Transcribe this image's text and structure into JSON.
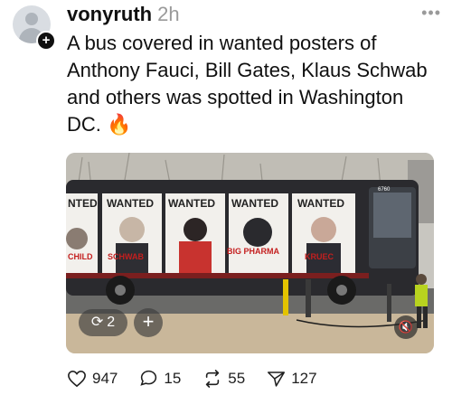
{
  "post": {
    "username": "vonyruth",
    "time": "2h",
    "caption": "A bus covered in wanted posters of Anthony Fauci, Bill Gates, Klaus Schwab and others was spotted in Washington DC. 🔥",
    "more_label": "•••"
  },
  "media": {
    "repost_count": "2",
    "add_label": "+",
    "poster_labels": [
      "NTED",
      "WANTED",
      "WANTED",
      "WANTED",
      "WANTED"
    ],
    "bottom_labels": [
      "CHILD",
      "SCHWAB",
      "",
      "BIG PHARMA",
      "KRUEC"
    ],
    "bus_number": "6760"
  },
  "actions": {
    "likes": "947",
    "replies": "15",
    "reposts": "55",
    "shares": "127"
  },
  "colors": {
    "poster_bg": "#f2f0ec",
    "poster_red": "#c41f1f",
    "bus_dark": "#2a2a2e"
  }
}
